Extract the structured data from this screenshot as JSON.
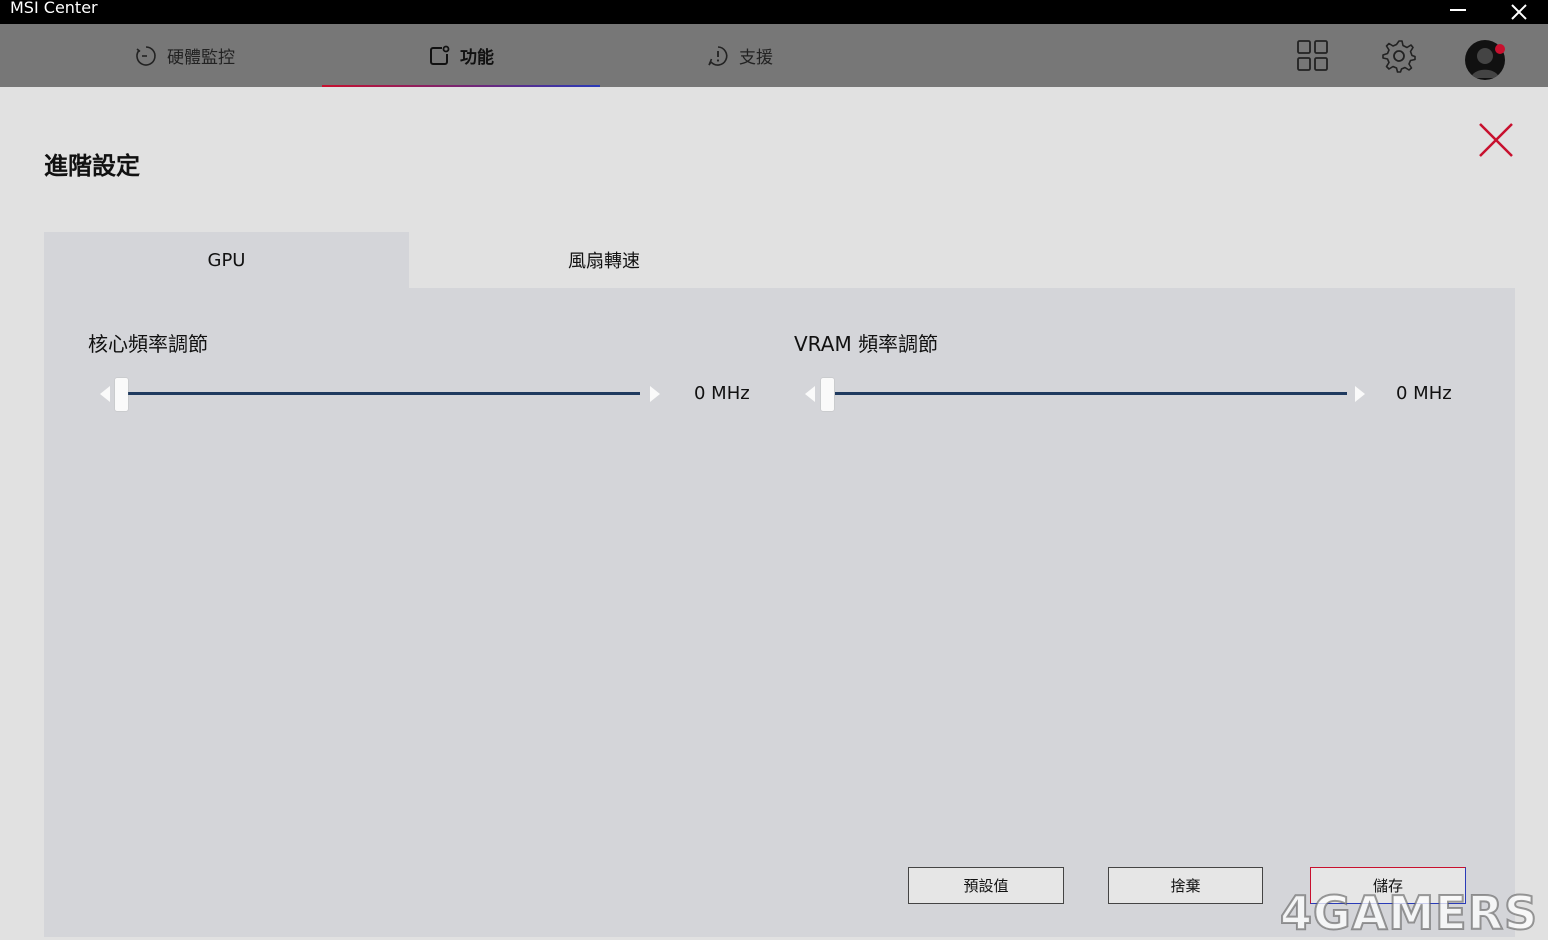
{
  "window": {
    "title": "MSI Center"
  },
  "nav": {
    "tabs": [
      {
        "label": "硬體監控",
        "icon": "gauge-icon"
      },
      {
        "label": "功能",
        "icon": "feature-icon",
        "active": true
      },
      {
        "label": "支援",
        "icon": "support-icon"
      }
    ],
    "icons": [
      "apps-grid-icon",
      "gear-icon",
      "avatar"
    ]
  },
  "page": {
    "title": "進階設定",
    "tabs": [
      {
        "label": "GPU",
        "active": true
      },
      {
        "label": "風扇轉速"
      }
    ],
    "core": {
      "label": "核心頻率調節",
      "value": "0 MHz",
      "level": 0
    },
    "vram": {
      "label": "VRAM 頻率調節",
      "value": "0 MHz",
      "level": 0
    },
    "buttons": {
      "default": "預設值",
      "discard": "捨棄",
      "save": "儲存"
    }
  },
  "colors": {
    "accent_red": "#c8102e",
    "accent_blue": "#2a3bb8",
    "slider_track": "#1f3a5f"
  },
  "watermark": "4GAMERS"
}
